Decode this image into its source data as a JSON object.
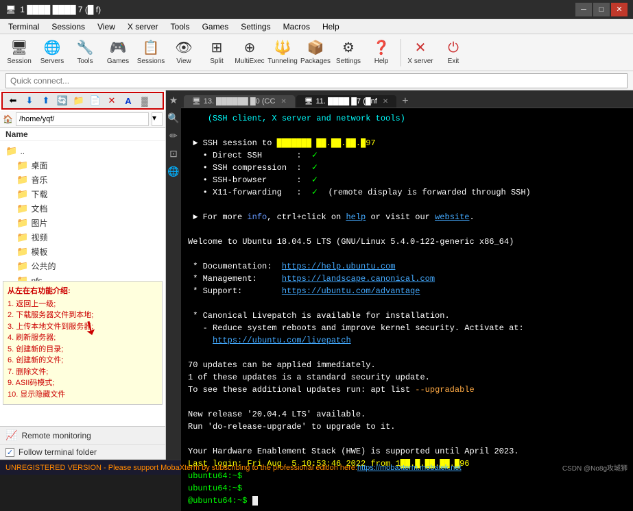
{
  "titleBar": {
    "title": "1 ████ ████ 7 (█ f)",
    "minBtn": "─",
    "maxBtn": "□",
    "closeBtn": "✕"
  },
  "menuBar": {
    "items": [
      "Terminal",
      "Sessions",
      "View",
      "X server",
      "Tools",
      "Games",
      "Settings",
      "Macros",
      "Help"
    ]
  },
  "toolbar": {
    "buttons": [
      {
        "label": "Session",
        "icon": "🖥"
      },
      {
        "label": "Servers",
        "icon": "🖧"
      },
      {
        "label": "Tools",
        "icon": "🔧"
      },
      {
        "label": "Games",
        "icon": "🎮"
      },
      {
        "label": "Sessions",
        "icon": "📋"
      },
      {
        "label": "View",
        "icon": "👁"
      },
      {
        "label": "Split",
        "icon": "⊞"
      },
      {
        "label": "MultiExec",
        "icon": "⊕"
      },
      {
        "label": "Tunneling",
        "icon": "🔱"
      },
      {
        "label": "Packages",
        "icon": "📦"
      },
      {
        "label": "Settings",
        "icon": "⚙"
      },
      {
        "label": "Help",
        "icon": "❓"
      },
      {
        "label": "X server",
        "icon": "✕"
      },
      {
        "label": "Exit",
        "icon": "⏻"
      }
    ]
  },
  "quickConnect": {
    "placeholder": "Quick connect..."
  },
  "leftPanel": {
    "toolbarBtns": [
      "⬅",
      "⬇",
      "⬆",
      "🔄",
      "📁+",
      "📄+",
      "✕",
      "A",
      "░"
    ],
    "pathValue": "/home/yqf/",
    "treeHeader": "Name",
    "treeItems": [
      {
        "name": "..",
        "type": "up",
        "icon": "📁"
      },
      {
        "name": "桌面",
        "type": "folder",
        "icon": "📁"
      },
      {
        "name": "音乐",
        "type": "folder",
        "icon": "📁"
      },
      {
        "name": "下载",
        "type": "folder",
        "icon": "📁"
      },
      {
        "name": "文档",
        "type": "folder",
        "icon": "📁"
      },
      {
        "name": "图片",
        "type": "folder",
        "icon": "📁"
      },
      {
        "name": "视频",
        "type": "folder",
        "icon": "📁"
      },
      {
        "name": "模板",
        "type": "folder",
        "icon": "📁"
      },
      {
        "name": "公共的",
        "type": "folder",
        "icon": "📁"
      },
      {
        "name": "nfs",
        "type": "folder",
        "icon": "📁"
      }
    ],
    "annotation": {
      "title": "从左在右功能介绍:",
      "items": [
        "1. 返回上一级;",
        "2. 下载服务器文件到本地;",
        "3. 上传本地文件到服务器;",
        "4. 刷新服务器;",
        "5. 创建新的目录;",
        "6. 创建新的文件;",
        "7. 删除文件;",
        "9. ASII码模式;",
        "10. 显示隐藏文件"
      ]
    },
    "monitoring": {
      "label": "Remote monitoring",
      "icon": "📊"
    },
    "followFolder": {
      "label": "Follow terminal folder",
      "checked": true
    }
  },
  "tabs": [
    {
      "label": "13. ██████ █0 (CC",
      "active": false,
      "icon": "🖥"
    },
    {
      "label": "11. ████ █7 (█nf",
      "active": true,
      "icon": "🖥"
    }
  ],
  "terminal": {
    "lines": [
      {
        "text": "    (SSH client, X server and network tools)",
        "class": "t-cyan"
      },
      {
        "text": "",
        "class": ""
      },
      {
        "text": " ► SSH session to ██████ ██.██.███.█97",
        "class": "t-white"
      },
      {
        "text": "   • Direct SSH       :  ✓",
        "class": "t-white"
      },
      {
        "text": "   • SSH compression  :  ✓",
        "class": "t-white"
      },
      {
        "text": "   • SSH-browser      :  ✓",
        "class": "t-white"
      },
      {
        "text": "   • X11-forwarding   :  ✓  (remote display is forwarded through SSH)",
        "class": "t-white"
      },
      {
        "text": "",
        "class": ""
      },
      {
        "text": " ► For more info, ctrl+click on help or visit our website.",
        "class": "t-white"
      },
      {
        "text": "",
        "class": ""
      },
      {
        "text": "Welcome to Ubuntu 18.04.5 LTS (GNU/Linux 5.4.0-122-generic x86_64)",
        "class": "t-white"
      },
      {
        "text": "",
        "class": ""
      },
      {
        "text": " * Documentation:  https://help.ubuntu.com",
        "class": "t-white"
      },
      {
        "text": " * Management:     https://landscape.canonical.com",
        "class": "t-white"
      },
      {
        "text": " * Support:        https://ubuntu.com/advantage",
        "class": "t-white"
      },
      {
        "text": "",
        "class": ""
      },
      {
        "text": " * Canonical Livepatch is available for installation.",
        "class": "t-white"
      },
      {
        "text": "   - Reduce system reboots and improve kernel security. Activate at:",
        "class": "t-white"
      },
      {
        "text": "     https://ubuntu.com/livepatch",
        "class": "t-link"
      },
      {
        "text": "",
        "class": ""
      },
      {
        "text": "70 updates can be applied immediately.",
        "class": "t-white"
      },
      {
        "text": "1 of these updates is a standard security update.",
        "class": "t-white"
      },
      {
        "text": "To see these additional updates run: apt list --upgradable",
        "class": "t-white"
      },
      {
        "text": "",
        "class": ""
      },
      {
        "text": "New release '20.04.4 LTS' available.",
        "class": "t-white"
      },
      {
        "text": "Run 'do-release-upgrade' to upgrade to it.",
        "class": "t-white"
      },
      {
        "text": "",
        "class": ""
      },
      {
        "text": "Your Hardware Enablement Stack (HWE) is supported until April 2023.",
        "class": "t-white"
      },
      {
        "text": "Last login: Fri Aug  5 10:53:46 2022 from 1██.█.██.██.█96",
        "class": "t-yellow"
      },
      {
        "text": "ubuntu64:~$",
        "class": "t-green"
      },
      {
        "text": "ubuntu64:~$",
        "class": "t-green"
      },
      {
        "text": "@ubuntu64:~$",
        "class": "t-green"
      }
    ]
  },
  "statusBar": {
    "text": "UNREGISTERED VERSION - Please support MobaXterm by subscribing to the professional edition here: ",
    "link": "https://mobaxterm.mobatek.net",
    "watermark": "CSDN @No8g攻城狮"
  }
}
